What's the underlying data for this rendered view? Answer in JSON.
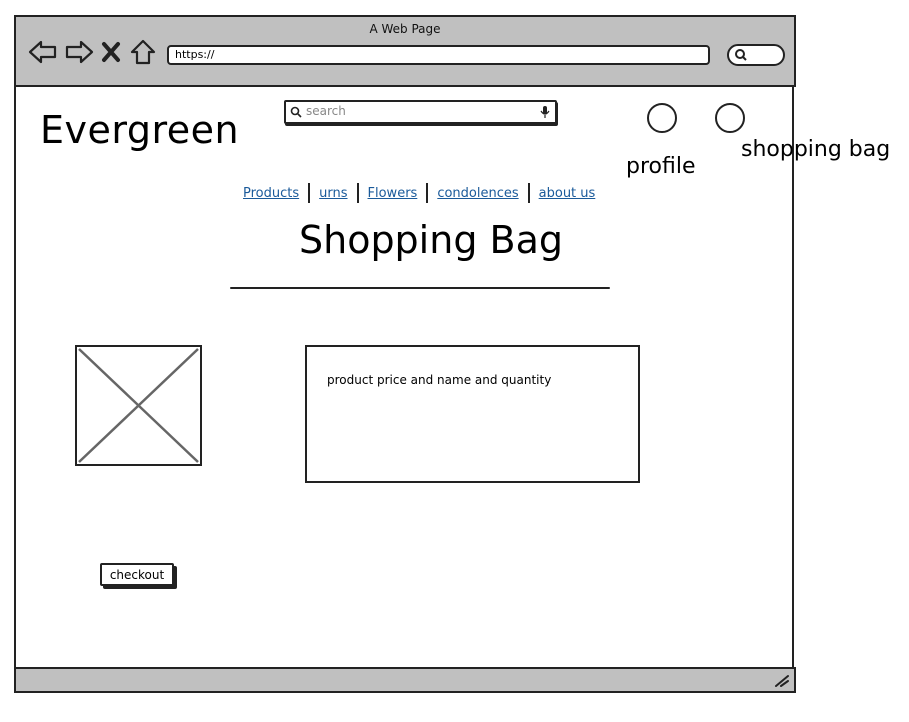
{
  "window": {
    "title": "A Web Page"
  },
  "browser": {
    "url": "https://"
  },
  "header": {
    "logo": "Evergreen",
    "search_placeholder": "search",
    "profile_label": "profile",
    "bag_label": "shopping bag"
  },
  "nav": {
    "links": [
      "Products",
      "urns",
      "Flowers",
      "condolences",
      "about us"
    ]
  },
  "main": {
    "title": "Shopping Bag",
    "product_text": "product price and name and quantity",
    "checkout_label": "checkout"
  },
  "colors": {
    "chrome": "#c0c0c0",
    "link": "#1a5a9a"
  },
  "icons": [
    "back-icon",
    "forward-icon",
    "stop-icon",
    "home-icon",
    "search-icon",
    "microphone-icon",
    "resize-grip-icon"
  ]
}
